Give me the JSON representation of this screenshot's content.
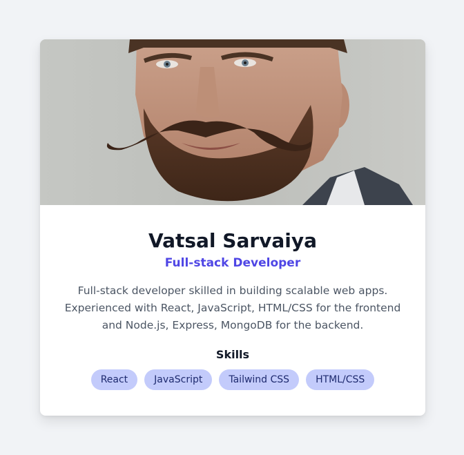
{
  "profile": {
    "name": "Vatsal Sarvaiya",
    "role": "Full-stack Developer",
    "bio": "Full-stack developer skilled in building scalable web apps. Experienced with React, JavaScript, HTML/CSS for the frontend and Node.js, Express, MongoDB for the backend."
  },
  "skills": {
    "title": "Skills",
    "items": [
      {
        "label": "React"
      },
      {
        "label": "JavaScript"
      },
      {
        "label": "Tailwind CSS"
      },
      {
        "label": "HTML/CSS"
      }
    ]
  },
  "colors": {
    "accent": "#4f46e5",
    "pill_bg": "#c3cbfb",
    "page_bg": "#f1f3f6"
  }
}
